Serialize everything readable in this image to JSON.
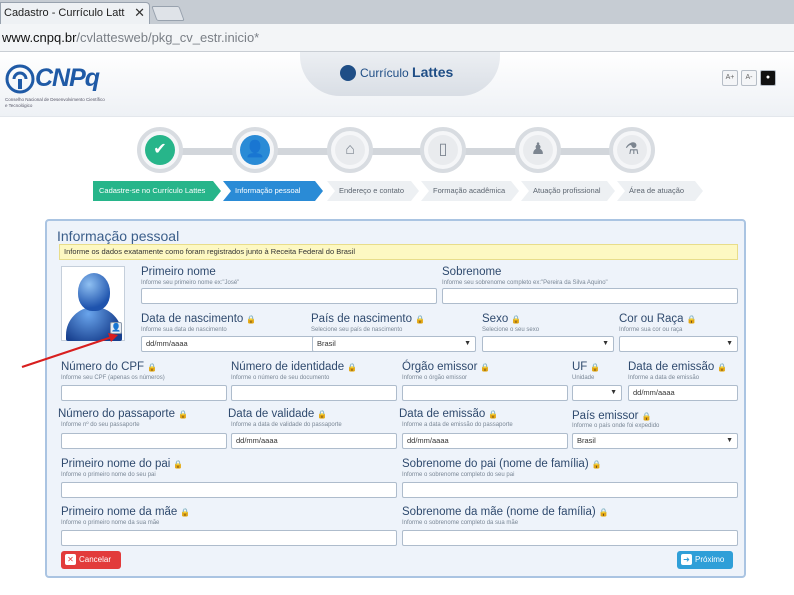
{
  "browser": {
    "tab_title": "Cadastro - Currículo Latt",
    "tab_close": "✕",
    "url_domain": "www.cnpq.br",
    "url_path": "/cvlattesweb/pkg_cv_estr.inicio*"
  },
  "header": {
    "logo_text": "CNPq",
    "logo_subtitle": "Conselho Nacional de Desenvolvimento Científico e Tecnológico",
    "banner_prefix": "Currículo",
    "banner_name": "Lattes",
    "font_increase": "A+",
    "font_decrease": "A-",
    "contrast": "●"
  },
  "steps": [
    {
      "icon": "checklist-icon",
      "state": "done",
      "glyph": "✔"
    },
    {
      "icon": "person-icon",
      "state": "current",
      "glyph": "👤"
    },
    {
      "icon": "house-icon",
      "state": "todo",
      "glyph": "⌂"
    },
    {
      "icon": "book-icon",
      "state": "todo",
      "glyph": "▯"
    },
    {
      "icon": "professional-icon",
      "state": "todo",
      "glyph": "♟"
    },
    {
      "icon": "research-icon",
      "state": "todo",
      "glyph": "⚗"
    }
  ],
  "breadcrumbs": [
    {
      "label": "Cadastre-se no Currículo Lattes",
      "state": "done"
    },
    {
      "label": "Informação pessoal",
      "state": "current"
    },
    {
      "label": "Endereço e contato",
      "state": "todo"
    },
    {
      "label": "Formação acadêmica",
      "state": "todo"
    },
    {
      "label": "Atuação profissional",
      "state": "todo"
    },
    {
      "label": "Área de atuação",
      "state": "todo"
    }
  ],
  "form": {
    "title": "Informação pessoal",
    "notice": "Informe os dados exatamente como foram registrados junto à Receita Federal do Brasil",
    "lock_glyph": "🔒",
    "first_name": {
      "label": "Primeiro nome",
      "hint": "Informe seu primeiro nome ex:\"José\"",
      "value": ""
    },
    "last_name": {
      "label": "Sobrenome",
      "hint": "Informe seu sobrenome completo ex:\"Pereira da Silva Aquino\"",
      "value": ""
    },
    "birth_date": {
      "label": "Data de nascimento",
      "hint": "Informe sua data de nascimento",
      "value": "dd/mm/aaaa"
    },
    "birth_country": {
      "label": "País de nascimento",
      "hint": "Selecione seu país de nascimento",
      "value": "Brasil"
    },
    "sex": {
      "label": "Sexo",
      "hint": "Selecione o seu sexo",
      "value": ""
    },
    "race": {
      "label": "Cor ou Raça",
      "hint": "Informe sua cor ou raça",
      "value": ""
    },
    "cpf": {
      "label": "Número do CPF",
      "hint": "Informe seu CPF (apenas os números)",
      "value": ""
    },
    "id_number": {
      "label": "Número de identidade",
      "hint": "Informe o número de seu documento",
      "value": ""
    },
    "issuer": {
      "label": "Órgão emissor",
      "hint": "Informe o órgão emissor",
      "value": ""
    },
    "uf": {
      "label": "UF",
      "hint": "Unidade",
      "value": ""
    },
    "issue_date": {
      "label": "Data de emissão",
      "hint": "Informe a data de emissão",
      "value": "dd/mm/aaaa"
    },
    "passport": {
      "label": "Número do passaporte",
      "hint": "Informe nº do seu passaporte",
      "value": ""
    },
    "validity": {
      "label": "Data de validade",
      "hint": "Informe a data de validade do passaporte",
      "value": "dd/mm/aaaa"
    },
    "passport_issue_date": {
      "label": "Data de emissão",
      "hint": "Informe a data de emissão do passaporte",
      "value": "dd/mm/aaaa"
    },
    "issuing_country": {
      "label": "País emissor",
      "hint": "Informe o país onde foi expedido",
      "value": "Brasil"
    },
    "father_first": {
      "label": "Primeiro nome do pai",
      "hint": "Informe o primeiro nome do seu pai",
      "value": ""
    },
    "father_last": {
      "label": "Sobrenome do pai (nome de família)",
      "hint": "Informe o sobrenome completo do seu pai",
      "value": ""
    },
    "mother_first": {
      "label": "Primeiro nome da mãe",
      "hint": "Informe o primeiro nome da sua mãe",
      "value": ""
    },
    "mother_last": {
      "label": "Sobrenome da mãe (nome de família)",
      "hint": "Informe o sobrenome completo da sua mãe",
      "value": ""
    },
    "cancel_label": "Cancelar",
    "next_label": "Próximo",
    "select_arrow": "▼",
    "photo_button": "👤"
  }
}
